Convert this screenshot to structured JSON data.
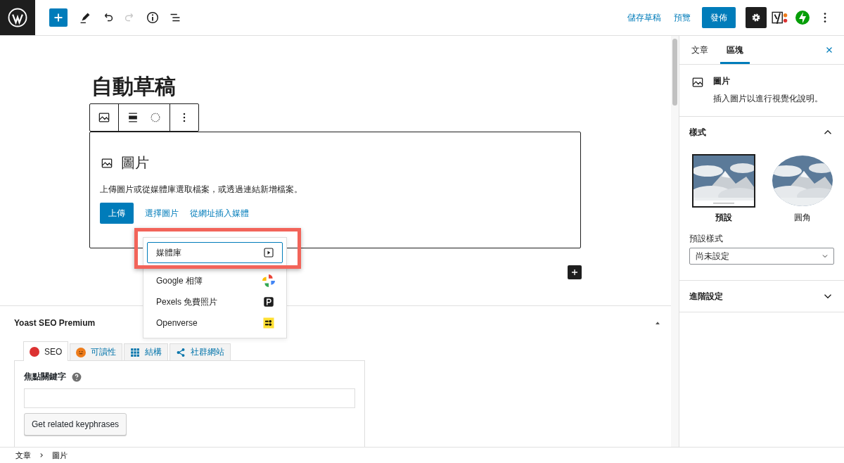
{
  "topbar": {
    "tools": [
      {
        "kind": "inserter",
        "disabled": false
      },
      {
        "kind": "edit",
        "disabled": false
      },
      {
        "kind": "undo",
        "disabled": false
      },
      {
        "kind": "redo",
        "disabled": true
      },
      {
        "kind": "info",
        "disabled": false
      },
      {
        "kind": "list",
        "disabled": false
      }
    ],
    "save_draft": "儲存草稿",
    "preview": "預覽",
    "publish": "發佈",
    "settings_active": true
  },
  "post_title": "自動草稿",
  "image_block": {
    "title": "圖片",
    "instructions": "上傳圖片或從媒體庫選取檔案，或透過連結新增檔案。",
    "upload": "上傳",
    "links": [
      "選擇圖片",
      "從網址插入媒體"
    ]
  },
  "media_menu": {
    "items": [
      {
        "label": "媒體庫",
        "kind": "library",
        "selected": true
      },
      {
        "label": "Google 相簿",
        "kind": "google",
        "selected": false
      },
      {
        "label": "Pexels 免費照片",
        "kind": "pexels",
        "selected": false
      },
      {
        "label": "Openverse",
        "kind": "openverse",
        "selected": false
      }
    ]
  },
  "yoast": {
    "title": "Yoast SEO Premium",
    "tabs": [
      {
        "label": "SEO",
        "kind": "score",
        "color": "#dc3232",
        "selected": true
      },
      {
        "label": "可讀性",
        "kind": "score",
        "color": "#ee7c1b",
        "selected": false
      },
      {
        "label": "結構",
        "kind": "grid",
        "selected": false
      },
      {
        "label": "社群網站",
        "kind": "share",
        "selected": false
      }
    ],
    "focus_keyphrase_label": "焦點關鍵字",
    "related_button": "Get related keyphrases"
  },
  "sidebar": {
    "tabs": [
      {
        "label": "文章",
        "selected": false
      },
      {
        "label": "區塊",
        "selected": true
      }
    ],
    "block": {
      "name": "圖片",
      "description": "插入圖片以進行視覺化說明。"
    },
    "styles_panel": {
      "title": "樣式",
      "expanded": true,
      "styles": [
        {
          "label": "預設",
          "kind": "default",
          "selected": true
        },
        {
          "label": "圓角",
          "kind": "rounded",
          "selected": false
        }
      ],
      "default_style_label": "預設樣式",
      "default_style_value": "尚未設定"
    },
    "advanced": {
      "title": "進階設定",
      "expanded": false
    }
  },
  "breadcrumb": [
    "文章",
    "圖片"
  ]
}
